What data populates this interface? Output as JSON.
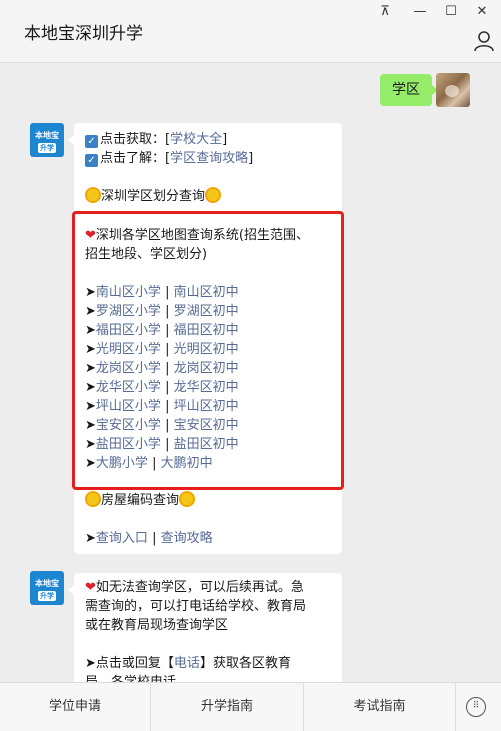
{
  "window": {
    "title": "本地宝深圳升学",
    "controls": {
      "pin": "⊼",
      "minimize": "—",
      "maximize": "☐",
      "close": "✕"
    }
  },
  "chat": {
    "outgoing": {
      "text": "学区"
    },
    "incoming_avatar": {
      "top": "本地宝",
      "bottom": "升学"
    },
    "message1": {
      "line1_prefix": "点击获取：[",
      "line1_link": "学校大全",
      "line1_suffix": "]",
      "line2_prefix": "点击了解：[",
      "line2_link": "学区查询攻略",
      "line2_suffix": "]",
      "section_title": "深圳学区划分查询",
      "box_title_1": "深圳各学区地图查询系统(招生范围、",
      "box_title_2": "招生地段、学区划分)",
      "districts": [
        {
          "primary": "南山区小学",
          "middle": "南山区初中"
        },
        {
          "primary": "罗湖区小学",
          "middle": "罗湖区初中"
        },
        {
          "primary": "福田区小学",
          "middle": "福田区初中"
        },
        {
          "primary": "光明区小学",
          "middle": "光明区初中"
        },
        {
          "primary": "龙岗区小学",
          "middle": "龙岗区初中"
        },
        {
          "primary": "龙华区小学",
          "middle": "龙华区初中"
        },
        {
          "primary": "坪山区小学",
          "middle": "坪山区初中"
        },
        {
          "primary": "宝安区小学",
          "middle": "宝安区初中"
        },
        {
          "primary": "盐田区小学",
          "middle": "盐田区初中"
        },
        {
          "primary": "大鹏小学",
          "middle": "大鹏初中"
        }
      ],
      "separator": "|",
      "arrow": "➤",
      "housing_title": "房屋编码查询",
      "housing_link1": "查询入口",
      "housing_link2": "查询攻略"
    },
    "message2": {
      "line1": "如无法查询学区，可以后续再试。急",
      "line2": "需查询的，可以打电话给学校、教育局",
      "line3": "或在教育局现场查询学区",
      "line4_prefix": "点击或回复【",
      "line4_link": "电话",
      "line4_suffix": "】获取各区教育",
      "line5": "局、各学校电话"
    }
  },
  "menu": {
    "items": [
      "学位申请",
      "升学指南",
      "考试指南"
    ]
  },
  "colors": {
    "accent_link": "#576b95",
    "bubble_out": "#95ec69",
    "highlight_border": "#e5201c"
  }
}
